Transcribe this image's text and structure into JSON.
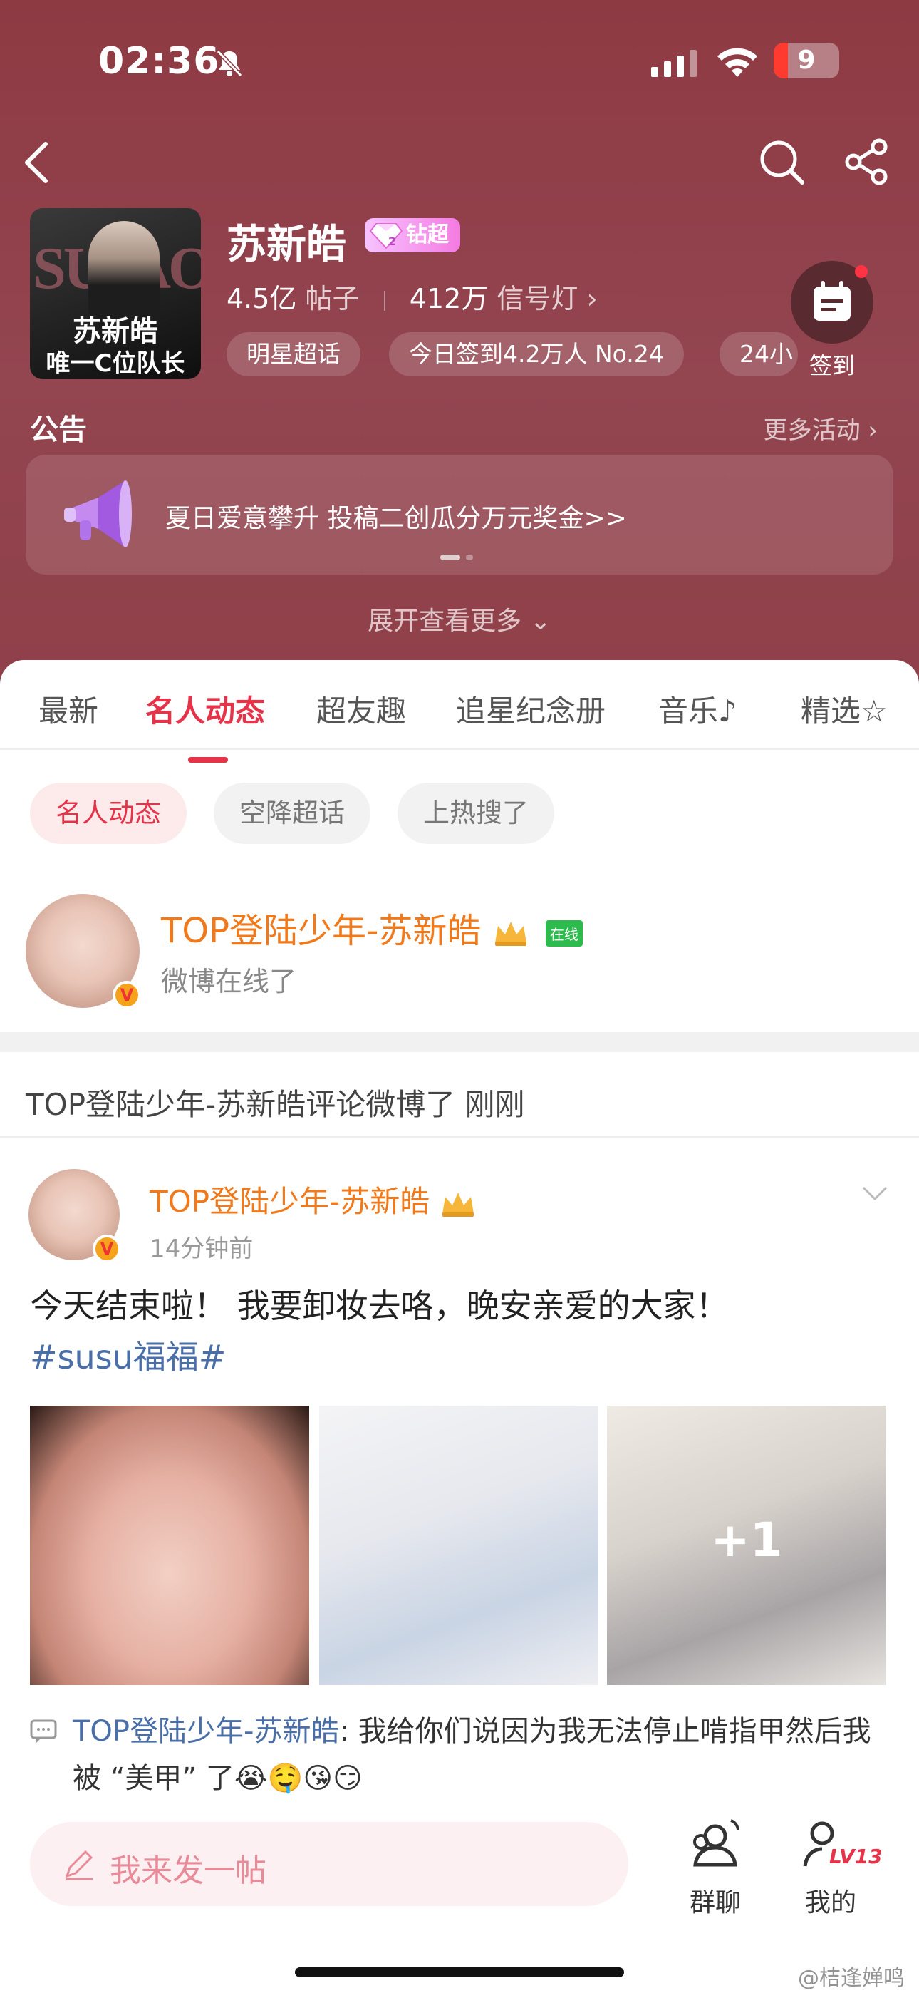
{
  "status": {
    "time": "02:36",
    "battery": "9"
  },
  "header": {
    "name": "苏新皓",
    "badge": "钻超",
    "cover_line1": "苏新皓",
    "cover_line2": "唯一C位队长",
    "posts_num": "4.5亿",
    "posts_label": "帖子",
    "signal_num": "412万",
    "signal_label": "信号灯",
    "signin_label": "签到",
    "chips": [
      "明星超话",
      "今日签到4.2万人 No.24",
      "24小"
    ]
  },
  "announcement": {
    "title": "公告",
    "more": "更多活动",
    "text": "夏日爱意攀升 投稿二创瓜分万元奖金>>",
    "expand": "展开查看更多"
  },
  "tabs": [
    "最新",
    "名人动态",
    "超友趣",
    "追星纪念册",
    "音乐",
    "精选"
  ],
  "filters": [
    "名人动态",
    "空降超话",
    "上热搜了"
  ],
  "online": {
    "name": "TOP登陆少年-苏新皓",
    "tag": "在线",
    "sub": "微博在线了"
  },
  "comment_line": "TOP登陆少年-苏新皓评论微博了 刚刚",
  "post": {
    "author": "TOP登陆少年-苏新皓",
    "time": "14分钟前",
    "text": "今天结束啦！ 我要卸妆去咯，晚安亲爱的大家！",
    "hashtag": "#susu福福#",
    "more_pics": "+1",
    "comment_user": "TOP登陆少年-苏新皓",
    "comment_text": ": 我给你们说因为我无法停止啃指甲然后我被 “美甲” 了😭🤤😘😏"
  },
  "bottom": {
    "compose_placeholder": "我来发一帖",
    "group_chat": "群聊",
    "mine": "我的",
    "level": "LV13"
  },
  "watermark": "@桔逢婵鸣",
  "colors": {
    "header_bg": "#8e3a43",
    "accent": "#e5344a",
    "author": "#f07a1b",
    "link": "#4a6ea8"
  }
}
